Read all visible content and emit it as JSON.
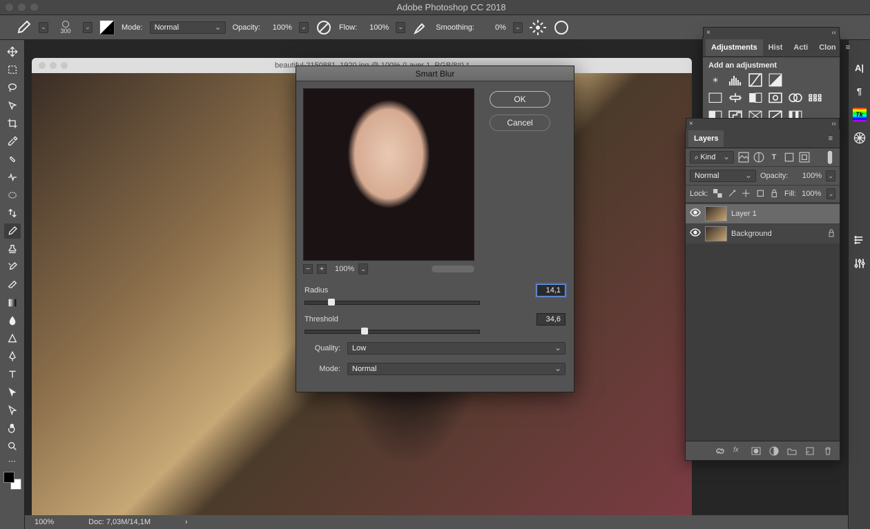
{
  "app": {
    "title": "Adobe Photoshop CC 2018"
  },
  "options_bar": {
    "brush_size": "300",
    "mode_label": "Mode:",
    "mode_value": "Normal",
    "opacity_label": "Opacity:",
    "opacity_value": "100%",
    "flow_label": "Flow:",
    "flow_value": "100%",
    "smoothing_label": "Smoothing:",
    "smoothing_value": "0%"
  },
  "document": {
    "tab_title": "beautiful-2150881_1920.jpg @ 100% (Layer 1, RGB/8#) *"
  },
  "statusbar": {
    "zoom": "100%",
    "doc_info": "Doc: 7,03M/14,1M"
  },
  "adjustments_panel": {
    "tabs": [
      "Adjustments",
      "Hist",
      "Acti",
      "Clon"
    ],
    "heading": "Add an adjustment"
  },
  "layers_panel": {
    "tabs": [
      "Layers"
    ],
    "filter_kind": "Kind",
    "blend_mode": "Normal",
    "opacity_label": "Opacity:",
    "opacity_value": "100%",
    "lock_label": "Lock:",
    "fill_label": "Fill:",
    "fill_value": "100%",
    "layers": [
      {
        "name": "Layer 1",
        "visible": true,
        "locked": false,
        "selected": true
      },
      {
        "name": "Background",
        "visible": true,
        "locked": true,
        "selected": false
      }
    ]
  },
  "dialog": {
    "title": "Smart Blur",
    "ok": "OK",
    "cancel": "Cancel",
    "zoom": "100%",
    "radius_label": "Radius",
    "radius_value": "14,1",
    "radius_percent": 15,
    "threshold_label": "Threshold",
    "threshold_value": "34,6",
    "threshold_percent": 34,
    "quality_label": "Quality:",
    "quality_value": "Low",
    "mode_label": "Mode:",
    "mode_value": "Normal"
  }
}
